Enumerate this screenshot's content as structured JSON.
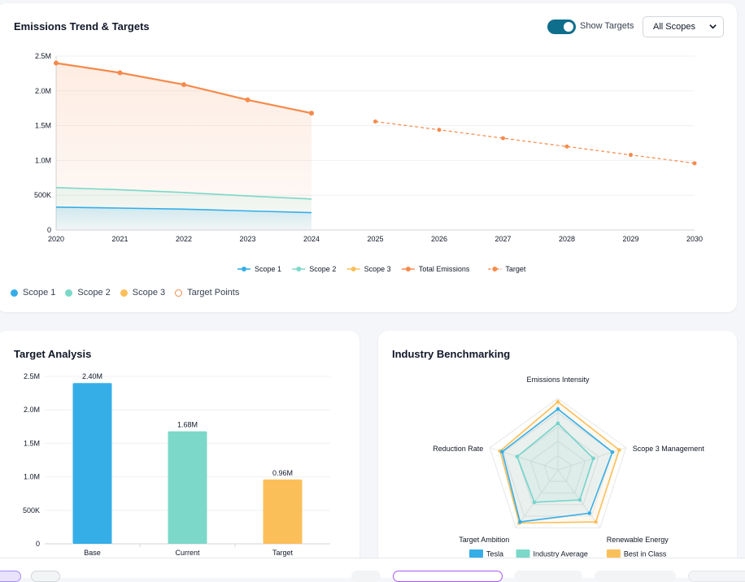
{
  "trend": {
    "title": "Emissions Trend & Targets",
    "toggle_label": "Show Targets",
    "toggle_on": true,
    "scope_select": "All Scopes",
    "legend_bottom": [
      {
        "label": "Scope 1",
        "color": "#35aee8"
      },
      {
        "label": "Scope 2",
        "color": "#7cd8c8"
      },
      {
        "label": "Scope 3",
        "color": "#fbbf5a"
      },
      {
        "label": "Target Points",
        "color": "#f58a4b"
      }
    ]
  },
  "target_analysis": {
    "title": "Target Analysis"
  },
  "benchmark": {
    "title": "Industry Benchmarking"
  },
  "chart_data": [
    {
      "type": "line",
      "title": "Emissions Trend & Targets",
      "x": [
        2020,
        2021,
        2022,
        2023,
        2024,
        2025,
        2026,
        2027,
        2028,
        2029,
        2030
      ],
      "x_ticks": [
        "2020",
        "2021",
        "2022",
        "2023",
        "2024",
        "2025",
        "2026",
        "2027",
        "2028",
        "2029",
        "2030"
      ],
      "y_ticks": [
        "0",
        "500K",
        "1.0M",
        "1.5M",
        "2.0M",
        "2.5M"
      ],
      "ylim": [
        0,
        2500000
      ],
      "grid": true,
      "legend": "bottom-center",
      "series": [
        {
          "name": "Scope 1",
          "color": "#35aee8",
          "x": [
            2020,
            2021,
            2022,
            2023,
            2024
          ],
          "values": [
            330000,
            315000,
            300000,
            275000,
            250000
          ]
        },
        {
          "name": "Scope 2",
          "color": "#7cd8c8",
          "x": [
            2020,
            2021,
            2022,
            2023,
            2024
          ],
          "values": [
            610000,
            580000,
            540000,
            490000,
            445000
          ]
        },
        {
          "name": "Scope 3",
          "color": "#fbbf5a",
          "x": [],
          "values": []
        },
        {
          "name": "Total Emissions",
          "color": "#f58a4b",
          "x": [
            2020,
            2021,
            2022,
            2023,
            2024
          ],
          "values": [
            2400000,
            2260000,
            2090000,
            1870000,
            1680000
          ]
        },
        {
          "name": "Target",
          "color": "#f58a4b",
          "dashed": true,
          "x": [
            2025,
            2026,
            2027,
            2028,
            2029,
            2030
          ],
          "values": [
            1560000,
            1440000,
            1320000,
            1200000,
            1080000,
            960000
          ]
        }
      ]
    },
    {
      "type": "bar",
      "title": "Target Analysis",
      "categories": [
        "Base",
        "Current",
        "Target"
      ],
      "values": [
        2400000,
        1680000,
        960000
      ],
      "data_labels": [
        "2.40M",
        "1.68M",
        "0.96M"
      ],
      "colors": [
        "#35aee8",
        "#7cd8c8",
        "#fbbf5a"
      ],
      "y_ticks": [
        "0",
        "500K",
        "1.0M",
        "1.5M",
        "2.0M",
        "2.5M"
      ],
      "ylim": [
        0,
        2500000
      ],
      "grid": true
    },
    {
      "type": "radar",
      "title": "Industry Benchmarking",
      "categories": [
        "Emissions Intensity",
        "Scope 3 Management",
        "Renewable Energy",
        "Target Ambition",
        "Reduction Rate"
      ],
      "rmax": 100,
      "legend": "bottom-center",
      "series": [
        {
          "name": "Tesla",
          "color": "#35aee8",
          "values": [
            85,
            80,
            75,
            90,
            82
          ]
        },
        {
          "name": "Industry Average",
          "color": "#7cd8c8",
          "values": [
            65,
            52,
            52,
            56,
            60
          ]
        },
        {
          "name": "Best in Class",
          "color": "#fbbf5a",
          "values": [
            95,
            90,
            90,
            92,
            85
          ]
        }
      ]
    }
  ]
}
